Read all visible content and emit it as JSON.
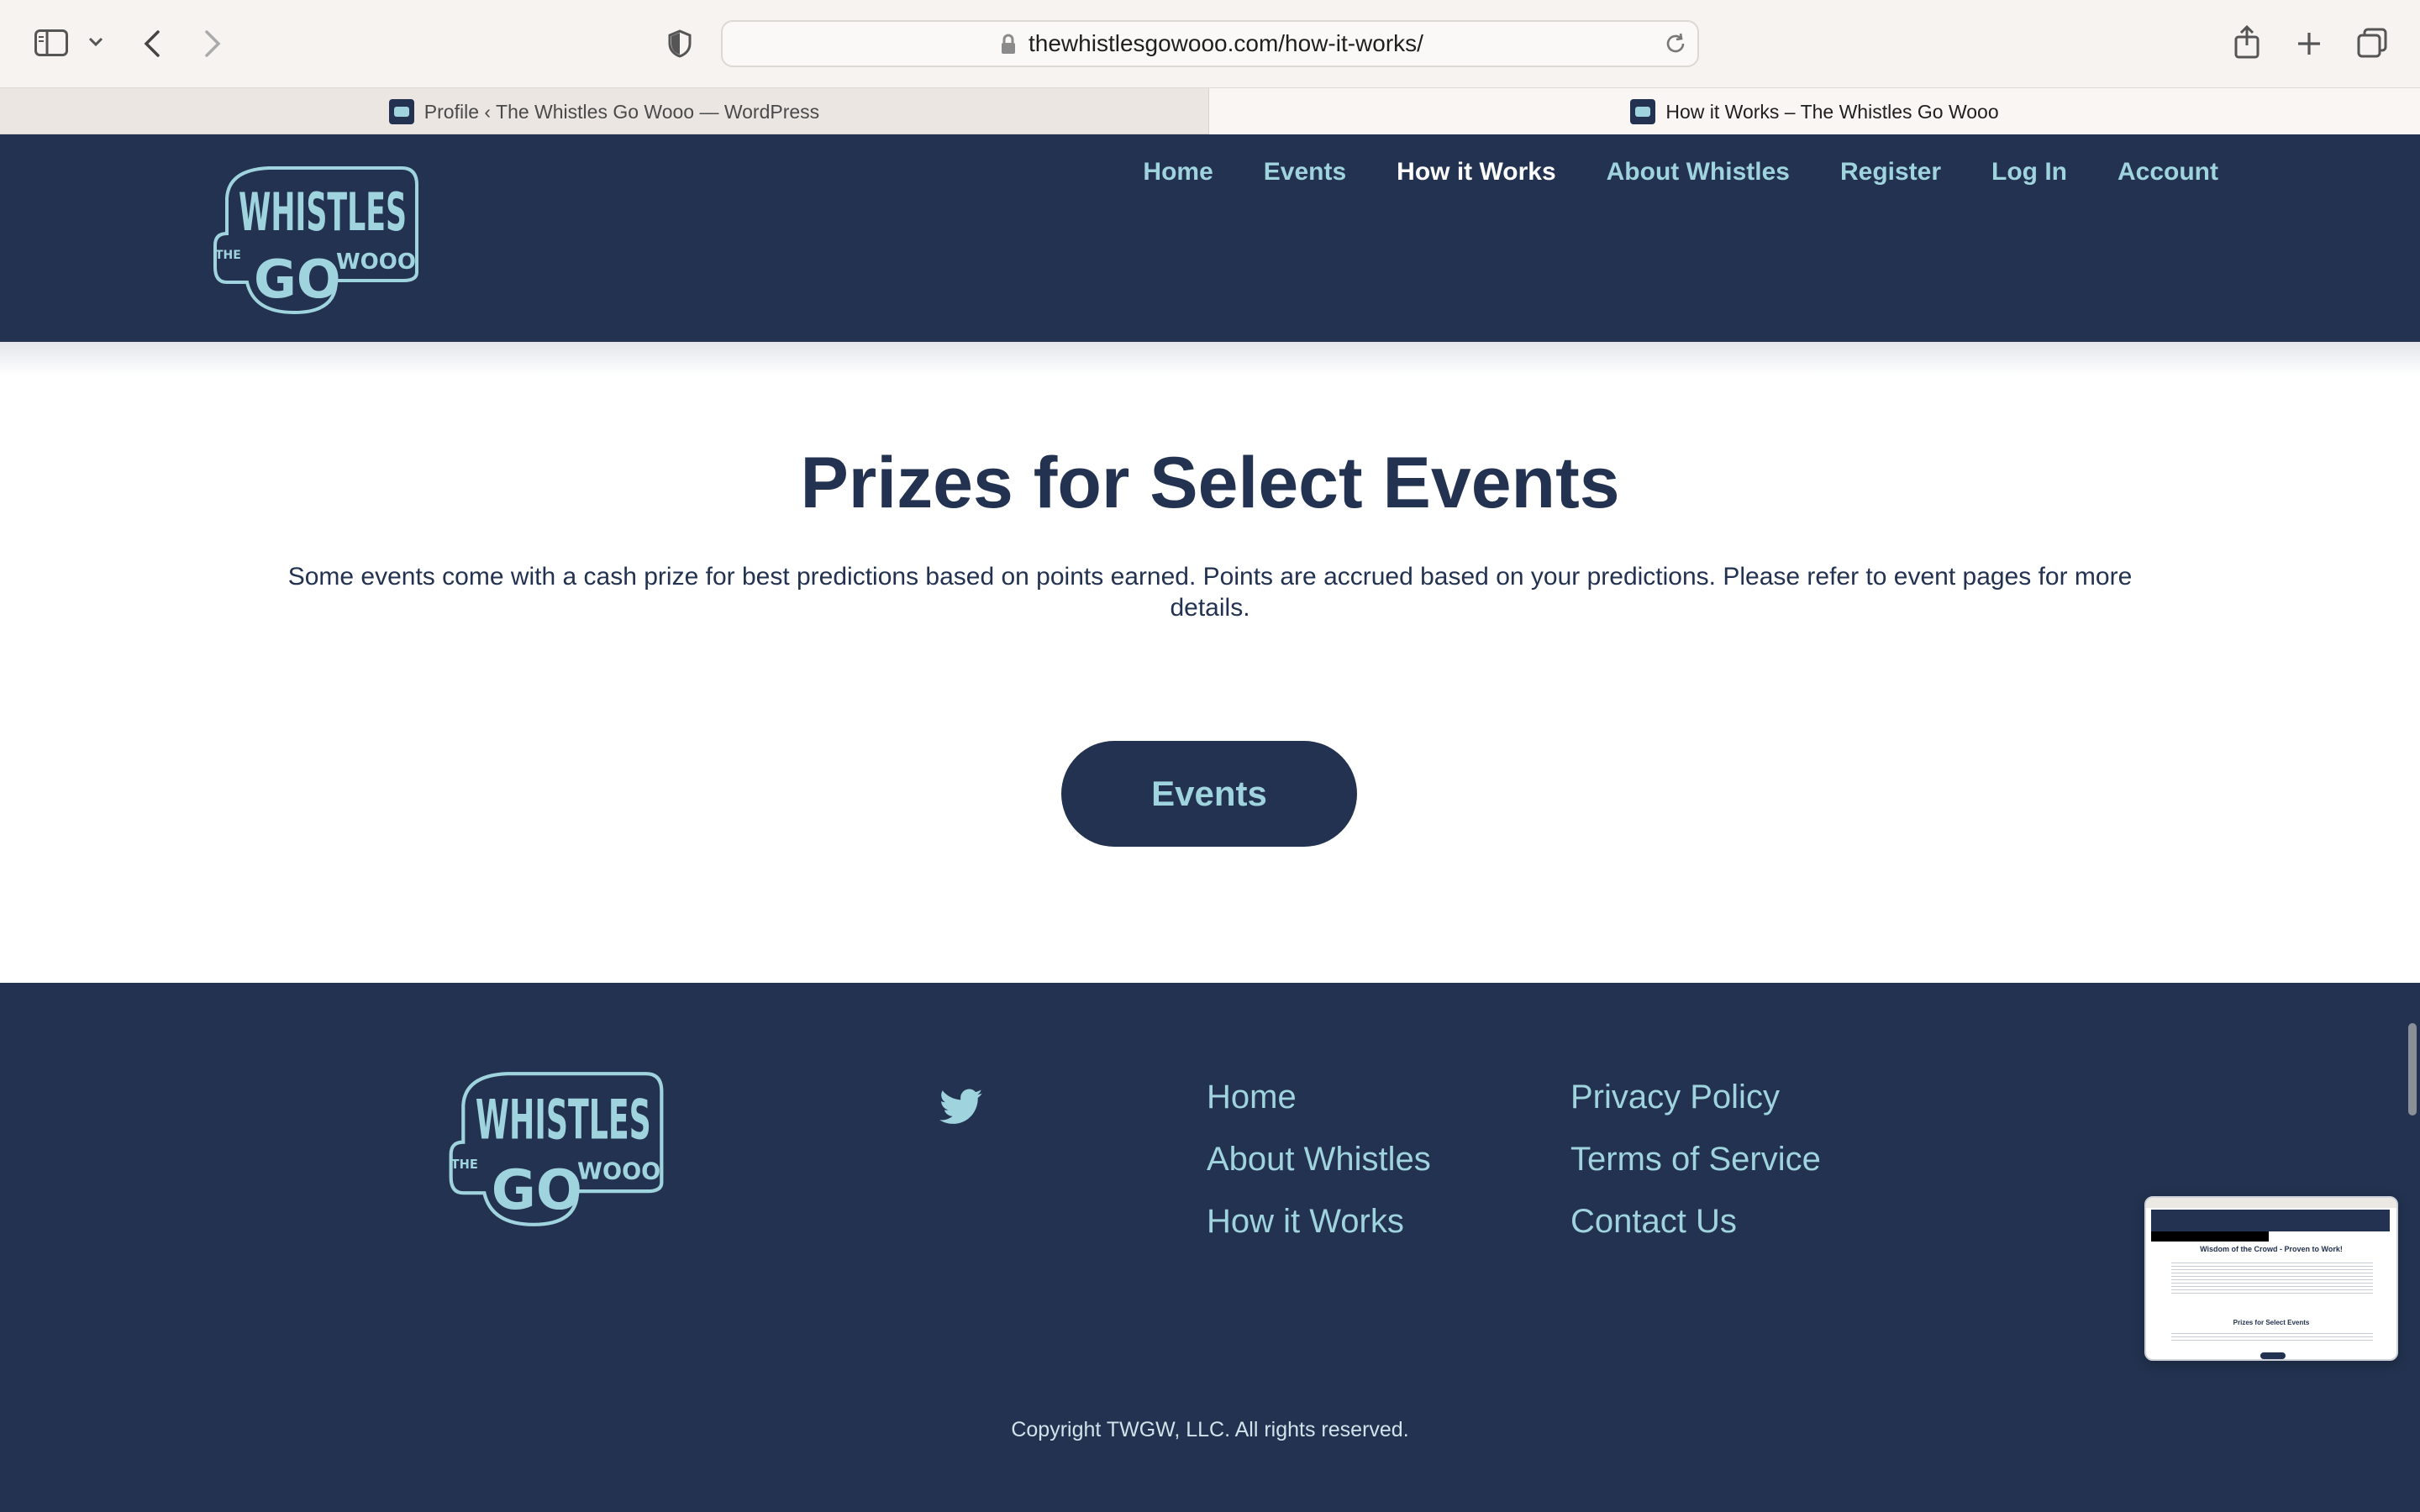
{
  "browser": {
    "url": "thewhistlesgowooo.com/how-it-works/",
    "tabs": [
      {
        "title": "Profile ‹ The Whistles Go Wooo — WordPress",
        "active": false
      },
      {
        "title": "How it Works – The Whistles Go Wooo",
        "active": true
      }
    ],
    "icons": [
      "sidebar-icon",
      "chevron-down-icon",
      "back-icon",
      "forward-icon",
      "shield-icon",
      "lock-icon",
      "reload-icon",
      "share-icon",
      "new-tab-icon",
      "tab-overview-icon"
    ]
  },
  "site": {
    "logo": {
      "text_the": "THE",
      "text_whistles": "WHISTLES",
      "text_go": "GO",
      "text_wooo": "WOOO",
      "color": "#9fd3dd"
    },
    "nav": [
      {
        "label": "Home",
        "current": false
      },
      {
        "label": "Events",
        "current": false
      },
      {
        "label": "How it Works",
        "current": true
      },
      {
        "label": "About Whistles",
        "current": false
      },
      {
        "label": "Register",
        "current": false
      },
      {
        "label": "Log In",
        "current": false
      },
      {
        "label": "Account",
        "current": false
      }
    ],
    "colors": {
      "navy": "#223250",
      "accent": "#9fd3dd"
    }
  },
  "main": {
    "title": "Prizes for Select Events",
    "text": "Some events come with a cash prize for best predictions based on points earned. Points are accrued based on your predictions. Please refer to event pages for more details.",
    "button_label": "Events"
  },
  "footer": {
    "links_col1": [
      "Home",
      "About Whistles",
      "How it Works"
    ],
    "links_col2": [
      "Privacy Policy",
      "Terms of Service",
      "Contact Us"
    ],
    "social_icon": "twitter-icon",
    "copyright": "Copyright TWGW, LLC. All rights reserved."
  },
  "preview": {
    "title": "Wisdom of the Crowd - Proven to Work!",
    "subtitle": "Prizes for Select Events"
  }
}
